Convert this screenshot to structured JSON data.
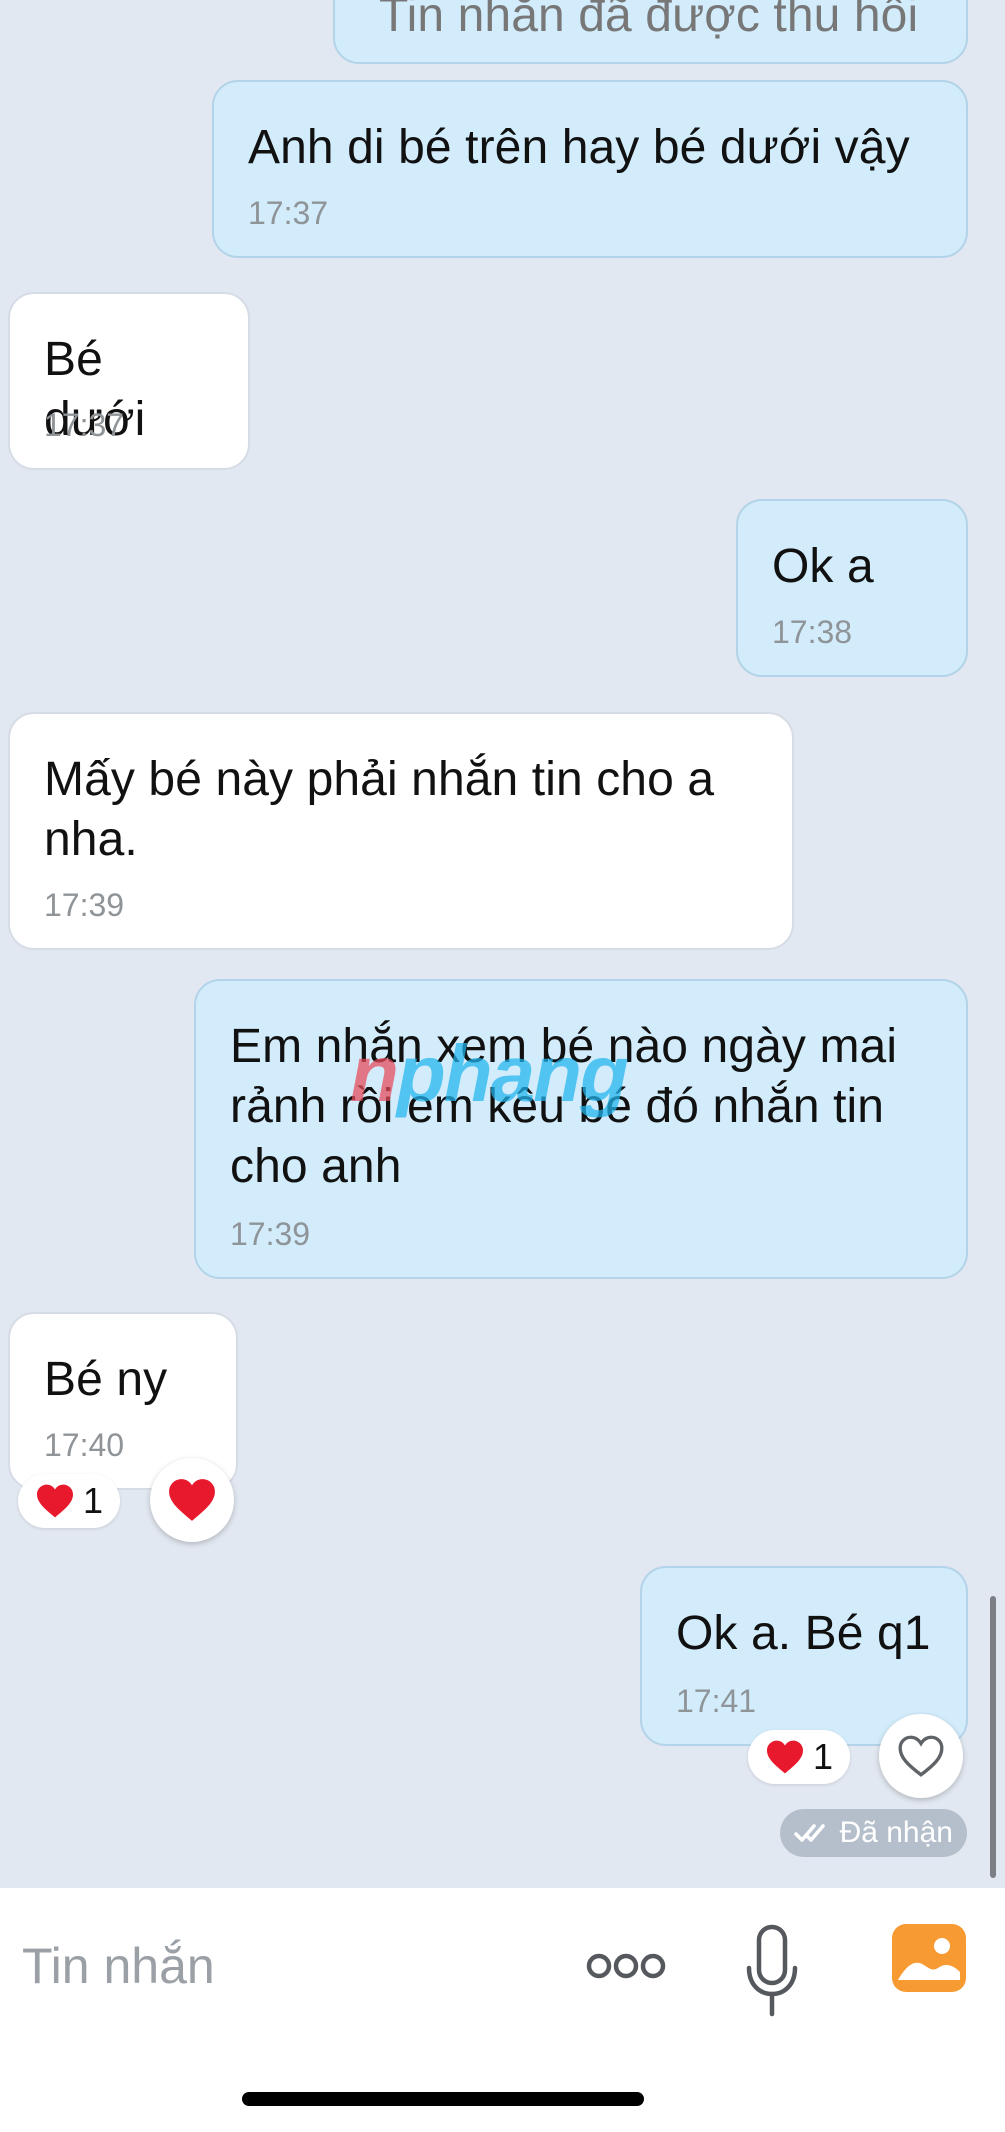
{
  "messages": [
    {
      "id": "m0",
      "direction": "out",
      "text": "Tin nhắn đã được thu hồi",
      "time": ""
    },
    {
      "id": "m1",
      "direction": "out",
      "text": "Anh di bé trên hay bé dưới vậy",
      "time": "17:37"
    },
    {
      "id": "m2",
      "direction": "in",
      "text": "Bé dưới",
      "time": "17:37"
    },
    {
      "id": "m3",
      "direction": "out",
      "text": "Ok a",
      "time": "17:38"
    },
    {
      "id": "m4",
      "direction": "in",
      "text": "Mấy bé này phải nhắn tin cho a nha.",
      "time": "17:39"
    },
    {
      "id": "m5",
      "direction": "out",
      "text": "Em nhắn xem bé nào ngày mai rảnh rồi em kêu bé đó nhắn tin cho anh",
      "time": "17:39"
    },
    {
      "id": "m6",
      "direction": "in",
      "text": "Bé ny",
      "time": "17:40",
      "reaction": {
        "emoji": "heart",
        "count": "1"
      }
    },
    {
      "id": "m7",
      "direction": "out",
      "text": "Ok a. Bé q1",
      "time": "17:41",
      "reaction": {
        "emoji": "heart",
        "count": "1"
      }
    }
  ],
  "status": {
    "label": "Đã nhận"
  },
  "watermark": {
    "part1": "n",
    "part2": "phang"
  },
  "composer": {
    "placeholder": "Tin nhắn"
  },
  "colors": {
    "background": "#e2e8f1",
    "outgoing_bubble": "#d2ecfb",
    "incoming_bubble": "#ffffff",
    "heart": "#e8192c",
    "image_button": "#f89a32"
  },
  "icons": {
    "more": "more-icon",
    "mic": "microphone-icon",
    "image": "image-icon",
    "heart": "heart-icon",
    "heart_outline": "heart-outline-icon",
    "check": "double-check-icon"
  }
}
